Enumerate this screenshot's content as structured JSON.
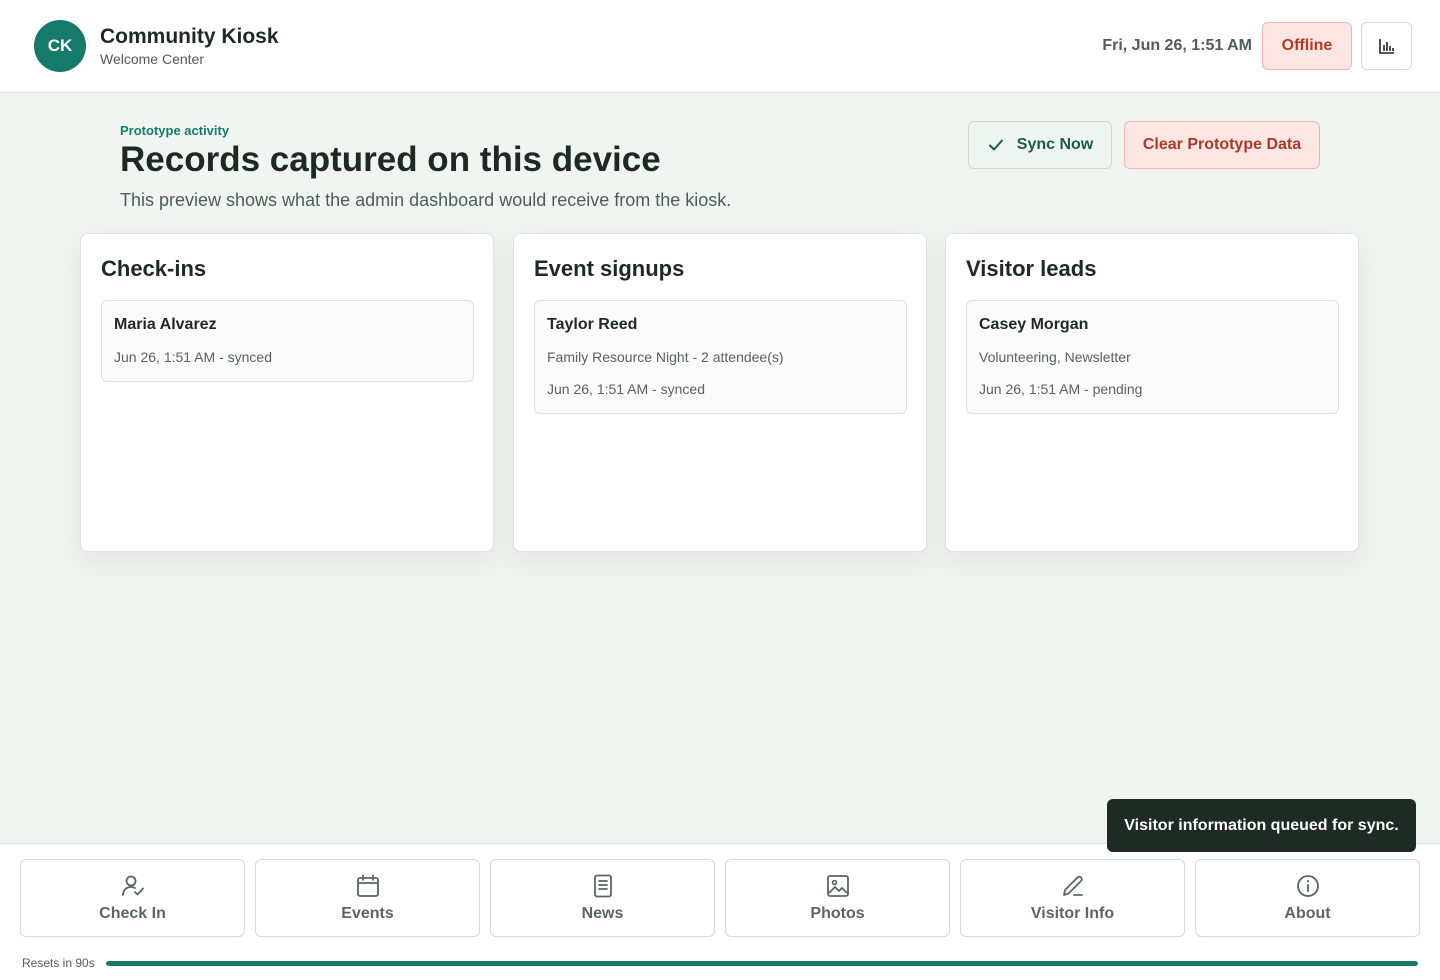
{
  "header": {
    "avatar_initials": "CK",
    "title": "Community Kiosk",
    "subtitle": "Welcome Center",
    "datetime": "Fri, Jun 26, 1:51 AM",
    "status": "Offline",
    "stats_icon": "bar-chart-icon"
  },
  "page": {
    "eyebrow": "Prototype activity",
    "title": "Records captured on this device",
    "description": "This preview shows what the admin dashboard would receive from the kiosk.",
    "sync_label": "Sync Now",
    "clear_label": "Clear Prototype Data"
  },
  "panels": [
    {
      "title": "Check-ins",
      "records": [
        {
          "name": "Maria Alvarez",
          "lines": [
            "Jun 26, 1:51 AM - synced"
          ]
        }
      ]
    },
    {
      "title": "Event signups",
      "records": [
        {
          "name": "Taylor Reed",
          "lines": [
            "Family Resource Night - 2 attendee(s)",
            "Jun 26, 1:51 AM - synced"
          ]
        }
      ]
    },
    {
      "title": "Visitor leads",
      "records": [
        {
          "name": "Casey Morgan",
          "lines": [
            "Volunteering, Newsletter",
            "Jun 26, 1:51 AM - pending"
          ]
        }
      ]
    }
  ],
  "toast": "Visitor information queued for sync.",
  "nav": [
    {
      "label": "Check In",
      "icon": "person-check-icon"
    },
    {
      "label": "Events",
      "icon": "calendar-icon"
    },
    {
      "label": "News",
      "icon": "document-icon"
    },
    {
      "label": "Photos",
      "icon": "image-icon"
    },
    {
      "label": "Visitor Info",
      "icon": "pencil-icon"
    },
    {
      "label": "About",
      "icon": "info-icon"
    }
  ],
  "reset": {
    "label": "Resets in 90s",
    "progress": 1.0
  },
  "colors": {
    "accent": "#167a6a",
    "danger": "#b23a25",
    "background": "#f1f5f1"
  }
}
